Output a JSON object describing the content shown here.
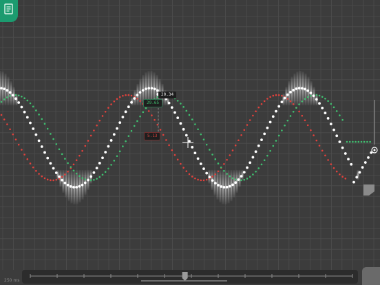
{
  "app": {
    "menu_icon": "document-list-icon",
    "accent_color": "#1c9b6f",
    "background_color": "#3c3c3c",
    "grid_color": "#4d4d4d"
  },
  "cursor": {
    "time_value": "20.34",
    "green_value": "29.65",
    "red_value": "5.13",
    "crosshair_icon": "crosshair-icon"
  },
  "footer": {
    "timescale_label": "250 ms",
    "play_icon": "play-icon"
  },
  "channels": [
    {
      "name": "white",
      "color": "#ffffff"
    },
    {
      "name": "green",
      "color": "#3fbf6f"
    },
    {
      "name": "red",
      "color": "#e0413c"
    }
  ],
  "slider": {
    "position": 0.48
  }
}
